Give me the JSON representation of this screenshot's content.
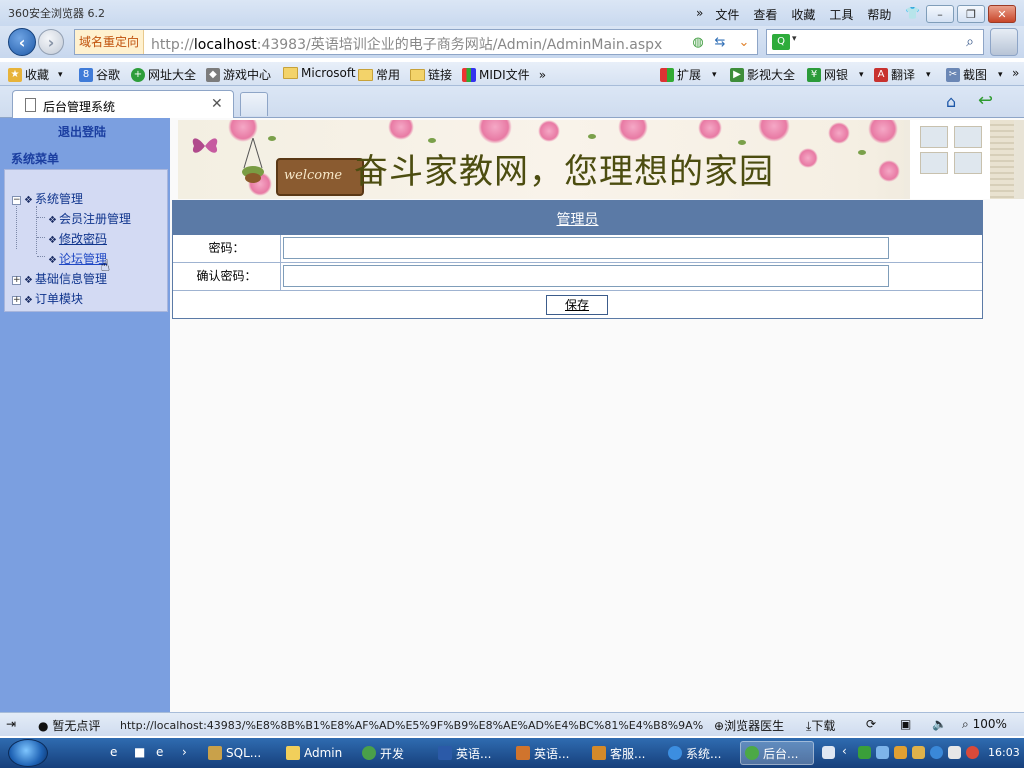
{
  "browser": {
    "title": "360安全浏览器 6.2",
    "menus": [
      "文件",
      "查看",
      "收藏",
      "工具",
      "帮助"
    ],
    "redirect_tag": "域名重定向",
    "url_host": "localhost",
    "url_prefix": "http://",
    "url_rest": ":43983/英语培训企业的电子商务网站/Admin/AdminMain.aspx",
    "favorites": {
      "collect": "收藏",
      "google": "谷歌",
      "nav": "网址大全",
      "games": "游戏中心",
      "microsoft": "Microsoft",
      "common": "常用",
      "links": "链接",
      "midi": "MIDI文件",
      "extend": "扩展",
      "video": "影视大全",
      "bank": "网银",
      "translate": "翻译",
      "screenshot": "截图"
    },
    "tab_title": "后台管理系统"
  },
  "sidebar": {
    "logout": "退出登陆",
    "menu_title": "系统菜单",
    "tree": {
      "system": "系统管理",
      "member_reg": "会员注册管理",
      "change_pwd": "修改密码",
      "forum": "论坛管理",
      "basic_info": "基础信息管理",
      "orders": "订单模块"
    }
  },
  "banner": {
    "headline": "奋斗家教网，您理想的家园",
    "welcome": "welcome"
  },
  "form": {
    "title": "管理员",
    "password_label": "密码：",
    "confirm_label": "确认密码：",
    "password_value": "",
    "confirm_value": "",
    "save_label": "保存"
  },
  "statusbar": {
    "rating": "暂无点评",
    "url": "http://localhost:43983/%E8%8B%B1%E8%AF%AD%E5%9F%B9%E8%AE%AD%E4%BC%81%E4%B8%9A%E7%9A%84",
    "doctor": "浏览器医生",
    "download": "下载",
    "zoom": "100%"
  },
  "taskbar": {
    "items": [
      "SQL...",
      "Admin",
      "开发",
      "英语...",
      "英语...",
      "客服...",
      "系统...",
      "后台..."
    ],
    "clock": "16:03"
  }
}
